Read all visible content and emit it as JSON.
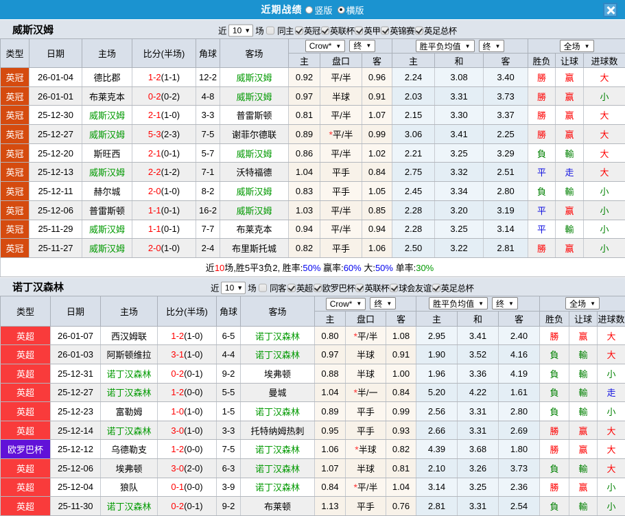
{
  "titlebar": {
    "title": "近期战绩",
    "radios": [
      {
        "label": "竖版",
        "selected": false
      },
      {
        "label": "横版",
        "selected": true
      }
    ]
  },
  "league_colors": {
    "英冠": "#d54b0f",
    "英超": "#f93b3b",
    "欧罗巴杯": "#6111d8"
  },
  "icons": {
    "chevron_down": "▼",
    "close": "close-x"
  },
  "result_colors": {
    "red": "#e60000",
    "green": "#008000",
    "blue": "#0f0fd0"
  },
  "header": {
    "col_headers": [
      "类型",
      "日期",
      "主场",
      "比分(半场)",
      "角球",
      "客场"
    ],
    "sub_headers": [
      "主",
      "盘口",
      "客",
      "主",
      "和",
      "客",
      "胜负",
      "让球",
      "进球数"
    ],
    "selects": {
      "odds": "Crow*",
      "odds_state": "终",
      "avg": "胜平负均值",
      "avg_state": "终",
      "scope": "全场"
    }
  },
  "sections": [
    {
      "team": "威斯汉姆",
      "controls": {
        "prefix": "近",
        "count": "10",
        "suffix": "场",
        "venue": {
          "label": "同主",
          "checked": false
        },
        "leagues": [
          {
            "label": "英冠",
            "checked": true
          },
          {
            "label": "英联杯",
            "checked": true
          },
          {
            "label": "英甲",
            "checked": true
          },
          {
            "label": "英锦赛",
            "checked": true
          },
          {
            "label": "英足总杯",
            "checked": true
          }
        ]
      },
      "rows": [
        {
          "league": "英冠",
          "date": "26-01-04",
          "home": "德比郡",
          "ft": "1-2",
          "ht": "(1-1)",
          "corner": "12-2",
          "away": "威斯汉姆",
          "o1": "0.92",
          "hc": "平/半",
          "o2": "0.96",
          "a1": "2.24",
          "a2": "3.08",
          "a3": "3.40",
          "r1": "勝",
          "r2": "赢",
          "r3": "大"
        },
        {
          "league": "英冠",
          "date": "26-01-01",
          "home": "布莱克本",
          "ft": "0-2",
          "ht": "(0-2)",
          "corner": "4-8",
          "away": "威斯汉姆",
          "o1": "0.97",
          "hc": "半球",
          "o2": "0.91",
          "a1": "2.03",
          "a2": "3.31",
          "a3": "3.73",
          "r1": "勝",
          "r2": "赢",
          "r3": "小"
        },
        {
          "league": "英冠",
          "date": "25-12-30",
          "home": "威斯汉姆",
          "ft": "2-1",
          "ht": "(1-0)",
          "corner": "3-3",
          "away": "普雷斯顿",
          "o1": "0.81",
          "hc": "平/半",
          "o2": "1.07",
          "a1": "2.15",
          "a2": "3.30",
          "a3": "3.37",
          "r1": "勝",
          "r2": "赢",
          "r3": "大"
        },
        {
          "league": "英冠",
          "date": "25-12-27",
          "home": "威斯汉姆",
          "ft": "5-3",
          "ht": "(2-3)",
          "corner": "7-5",
          "away": "谢菲尔德联",
          "o1": "0.89",
          "hc": "*平/半",
          "o2": "0.99",
          "a1": "3.06",
          "a2": "3.41",
          "a3": "2.25",
          "r1": "勝",
          "r2": "赢",
          "r3": "大"
        },
        {
          "league": "英冠",
          "date": "25-12-20",
          "home": "斯旺西",
          "ft": "2-1",
          "ht": "(0-1)",
          "corner": "5-7",
          "away": "威斯汉姆",
          "o1": "0.86",
          "hc": "平/半",
          "o2": "1.02",
          "a1": "2.21",
          "a2": "3.25",
          "a3": "3.29",
          "r1": "負",
          "r2": "輸",
          "r3": "大"
        },
        {
          "league": "英冠",
          "date": "25-12-13",
          "home": "威斯汉姆",
          "ft": "2-2",
          "ht": "(1-2)",
          "corner": "7-1",
          "away": "沃特福德",
          "o1": "1.04",
          "hc": "平手",
          "o2": "0.84",
          "a1": "2.75",
          "a2": "3.32",
          "a3": "2.51",
          "r1": "平",
          "r2": "走",
          "r3": "大"
        },
        {
          "league": "英冠",
          "date": "25-12-11",
          "home": "赫尔城",
          "ft": "2-0",
          "ht": "(1-0)",
          "corner": "8-2",
          "away": "威斯汉姆",
          "o1": "0.83",
          "hc": "平手",
          "o2": "1.05",
          "a1": "2.45",
          "a2": "3.34",
          "a3": "2.80",
          "r1": "負",
          "r2": "輸",
          "r3": "小"
        },
        {
          "league": "英冠",
          "date": "25-12-06",
          "home": "普雷斯顿",
          "ft": "1-1",
          "ht": "(0-1)",
          "corner": "16-2",
          "away": "威斯汉姆",
          "o1": "1.03",
          "hc": "平/半",
          "o2": "0.85",
          "a1": "2.28",
          "a2": "3.20",
          "a3": "3.19",
          "r1": "平",
          "r2": "赢",
          "r3": "小"
        },
        {
          "league": "英冠",
          "date": "25-11-29",
          "home": "威斯汉姆",
          "ft": "1-1",
          "ht": "(0-1)",
          "corner": "7-7",
          "away": "布莱克本",
          "o1": "0.94",
          "hc": "平/半",
          "o2": "0.94",
          "a1": "2.28",
          "a2": "3.25",
          "a3": "3.14",
          "r1": "平",
          "r2": "輸",
          "r3": "小"
        },
        {
          "league": "英冠",
          "date": "25-11-27",
          "home": "威斯汉姆",
          "ft": "2-0",
          "ht": "(1-0)",
          "corner": "2-4",
          "away": "布里斯托城",
          "o1": "0.82",
          "hc": "平手",
          "o2": "1.06",
          "a1": "2.50",
          "a2": "3.22",
          "a3": "2.81",
          "r1": "勝",
          "r2": "赢",
          "r3": "小"
        }
      ],
      "summary": [
        {
          "t": "近"
        },
        {
          "t": "10",
          "c": "s-red"
        },
        {
          "t": "场,胜5平3负2, 胜率:"
        },
        {
          "t": "50%",
          "c": "s-blue"
        },
        {
          "t": " 赢率:"
        },
        {
          "t": "60%",
          "c": "s-blue"
        },
        {
          "t": " 大:"
        },
        {
          "t": "50%",
          "c": "s-blue"
        },
        {
          "t": " 单率:"
        },
        {
          "t": "30%",
          "c": "s-green"
        }
      ]
    },
    {
      "team": "诺丁汉森林",
      "controls": {
        "prefix": "近",
        "count": "10",
        "suffix": "场",
        "venue": {
          "label": "同客",
          "checked": false
        },
        "leagues": [
          {
            "label": "英超",
            "checked": true
          },
          {
            "label": "欧罗巴杯",
            "checked": true
          },
          {
            "label": "英联杯",
            "checked": true
          },
          {
            "label": "球会友谊",
            "checked": true
          },
          {
            "label": "英足总杯",
            "checked": true
          }
        ]
      },
      "rows": [
        {
          "league": "英超",
          "date": "26-01-07",
          "home": "西汉姆联",
          "ft": "1-2",
          "ht": "(1-0)",
          "corner": "6-5",
          "away": "诺丁汉森林",
          "o1": "0.80",
          "hc": "*平/半",
          "o2": "1.08",
          "a1": "2.95",
          "a2": "3.41",
          "a3": "2.40",
          "r1": "勝",
          "r2": "赢",
          "r3": "大"
        },
        {
          "league": "英超",
          "date": "26-01-03",
          "home": "阿斯顿维拉",
          "ft": "3-1",
          "ht": "(1-0)",
          "corner": "4-4",
          "away": "诺丁汉森林",
          "o1": "0.97",
          "hc": "半球",
          "o2": "0.91",
          "a1": "1.90",
          "a2": "3.52",
          "a3": "4.16",
          "r1": "負",
          "r2": "輸",
          "r3": "大"
        },
        {
          "league": "英超",
          "date": "25-12-31",
          "home": "诺丁汉森林",
          "ft": "0-2",
          "ht": "(0-1)",
          "corner": "9-2",
          "away": "埃弗顿",
          "o1": "0.88",
          "hc": "半球",
          "o2": "1.00",
          "a1": "1.96",
          "a2": "3.36",
          "a3": "4.19",
          "r1": "負",
          "r2": "輸",
          "r3": "小"
        },
        {
          "league": "英超",
          "date": "25-12-27",
          "home": "诺丁汉森林",
          "ft": "1-2",
          "ht": "(0-0)",
          "corner": "5-5",
          "away": "曼城",
          "o1": "1.04",
          "hc": "*半/一",
          "o2": "0.84",
          "a1": "5.20",
          "a2": "4.22",
          "a3": "1.61",
          "r1": "負",
          "r2": "輸",
          "r3": "走"
        },
        {
          "league": "英超",
          "date": "25-12-23",
          "home": "富勒姆",
          "ft": "1-0",
          "ht": "(1-0)",
          "corner": "1-5",
          "away": "诺丁汉森林",
          "o1": "0.89",
          "hc": "平手",
          "o2": "0.99",
          "a1": "2.56",
          "a2": "3.31",
          "a3": "2.80",
          "r1": "負",
          "r2": "輸",
          "r3": "小"
        },
        {
          "league": "英超",
          "date": "25-12-14",
          "home": "诺丁汉森林",
          "ft": "3-0",
          "ht": "(1-0)",
          "corner": "3-3",
          "away": "托特纳姆热刺",
          "o1": "0.95",
          "hc": "平手",
          "o2": "0.93",
          "a1": "2.66",
          "a2": "3.31",
          "a3": "2.69",
          "r1": "勝",
          "r2": "赢",
          "r3": "大"
        },
        {
          "league": "欧罗巴杯",
          "date": "25-12-12",
          "home": "乌德勒支",
          "ft": "1-2",
          "ht": "(0-0)",
          "corner": "7-5",
          "away": "诺丁汉森林",
          "o1": "1.06",
          "hc": "*半球",
          "o2": "0.82",
          "a1": "4.39",
          "a2": "3.68",
          "a3": "1.80",
          "r1": "勝",
          "r2": "赢",
          "r3": "大"
        },
        {
          "league": "英超",
          "date": "25-12-06",
          "home": "埃弗顿",
          "ft": "3-0",
          "ht": "(2-0)",
          "corner": "6-3",
          "away": "诺丁汉森林",
          "o1": "1.07",
          "hc": "半球",
          "o2": "0.81",
          "a1": "2.10",
          "a2": "3.26",
          "a3": "3.73",
          "r1": "負",
          "r2": "輸",
          "r3": "大"
        },
        {
          "league": "英超",
          "date": "25-12-04",
          "home": "狼队",
          "ft": "0-1",
          "ht": "(0-0)",
          "corner": "3-9",
          "away": "诺丁汉森林",
          "o1": "0.84",
          "hc": "*平/半",
          "o2": "1.04",
          "a1": "3.14",
          "a2": "3.25",
          "a3": "2.36",
          "r1": "勝",
          "r2": "赢",
          "r3": "小"
        },
        {
          "league": "英超",
          "date": "25-11-30",
          "home": "诺丁汉森林",
          "ft": "0-2",
          "ht": "(0-1)",
          "corner": "9-2",
          "away": "布莱顿",
          "o1": "1.13",
          "hc": "平手",
          "o2": "0.76",
          "a1": "2.81",
          "a2": "3.31",
          "a3": "2.54",
          "r1": "負",
          "r2": "輸",
          "r3": "小"
        }
      ],
      "summary": null
    }
  ]
}
